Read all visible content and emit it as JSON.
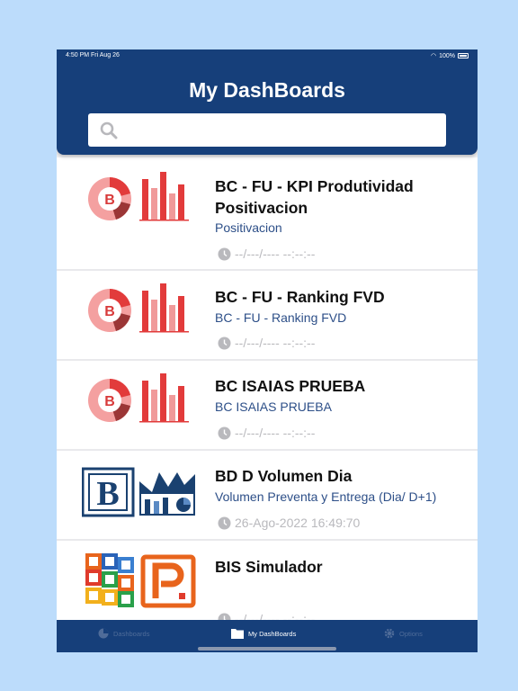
{
  "status_bar": {
    "time": "4:50 PM   Fri Aug 26",
    "battery": "100%"
  },
  "header": {
    "title": "My DashBoards"
  },
  "search": {
    "placeholder": ""
  },
  "dashboards": [
    {
      "title": "BC - FU - KPI Produtividad Positivacion",
      "subtitle": "Positivacion",
      "date": "--/---/---- --:--:--",
      "icon": "pie-bar-chart-b-logo"
    },
    {
      "title": "BC - FU - Ranking FVD",
      "subtitle": "BC - FU - Ranking FVD",
      "date": "--/---/---- --:--:--",
      "icon": "pie-bar-chart-b-logo"
    },
    {
      "title": "BC ISAIAS PRUEBA",
      "subtitle": "BC ISAIAS PRUEBA",
      "date": "--/---/---- --:--:--",
      "icon": "pie-bar-chart-b-logo"
    },
    {
      "title": "BD D Volumen Dia",
      "subtitle": "Volumen Preventa y Entrega (Dia/ D+1)",
      "date": "26-Ago-2022 16:49:70",
      "icon": "b-factory-logo"
    },
    {
      "title": "BIS Simulador",
      "subtitle": "",
      "date": "--/---/---- --:--:--",
      "icon": "colorful-puzzle-p-logo"
    }
  ],
  "tabs": [
    {
      "label": "Dashboards",
      "icon": "pie-chart-icon",
      "active": false
    },
    {
      "label": "My DashBoards",
      "icon": "folder-icon",
      "active": true
    },
    {
      "label": "Options",
      "icon": "gear-icon",
      "active": false
    }
  ],
  "colors": {
    "header": "#163f7a",
    "subtitle": "#2d4f88",
    "background": "#bcdcfb",
    "date": "#b9b9bd"
  }
}
